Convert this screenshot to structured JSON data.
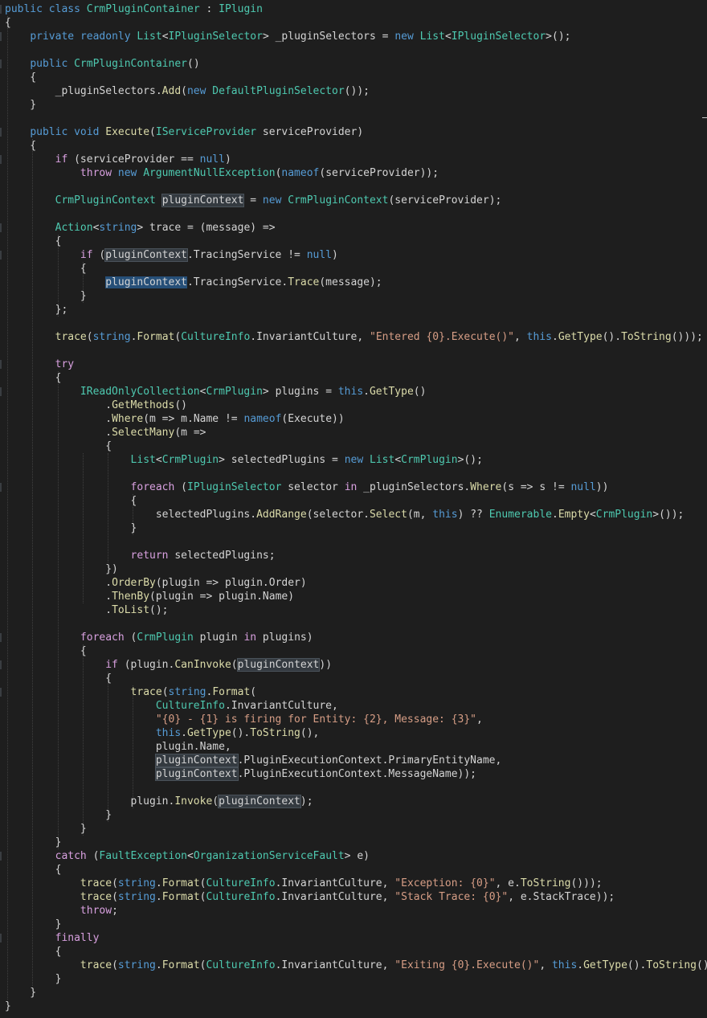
{
  "code_lines": [
    {
      "tokens": [
        {
          "t": "public",
          "c": "kw"
        },
        {
          "t": " "
        },
        {
          "t": "class",
          "c": "kw"
        },
        {
          "t": " "
        },
        {
          "t": "CrmPluginContainer",
          "c": "ty"
        },
        {
          "t": " : "
        },
        {
          "t": "IPlugin",
          "c": "ty"
        }
      ]
    },
    {
      "tokens": [
        {
          "t": "{"
        }
      ]
    },
    {
      "tokens": [
        {
          "t": "    "
        },
        {
          "t": "private",
          "c": "kw"
        },
        {
          "t": " "
        },
        {
          "t": "readonly",
          "c": "kw"
        },
        {
          "t": " "
        },
        {
          "t": "List",
          "c": "ty"
        },
        {
          "t": "<"
        },
        {
          "t": "IPluginSelector",
          "c": "ty"
        },
        {
          "t": "> _pluginSelectors = "
        },
        {
          "t": "new",
          "c": "kw"
        },
        {
          "t": " "
        },
        {
          "t": "List",
          "c": "ty"
        },
        {
          "t": "<"
        },
        {
          "t": "IPluginSelector",
          "c": "ty"
        },
        {
          "t": ">();"
        }
      ]
    },
    {
      "tokens": []
    },
    {
      "tokens": [
        {
          "t": "    "
        },
        {
          "t": "public",
          "c": "kw"
        },
        {
          "t": " "
        },
        {
          "t": "CrmPluginContainer",
          "c": "ty"
        },
        {
          "t": "()"
        }
      ]
    },
    {
      "tokens": [
        {
          "t": "    {"
        }
      ]
    },
    {
      "tokens": [
        {
          "t": "        _pluginSelectors."
        },
        {
          "t": "Add",
          "c": "fn"
        },
        {
          "t": "("
        },
        {
          "t": "new",
          "c": "kw"
        },
        {
          "t": " "
        },
        {
          "t": "DefaultPluginSelector",
          "c": "ty"
        },
        {
          "t": "());"
        }
      ]
    },
    {
      "tokens": [
        {
          "t": "    }"
        }
      ]
    },
    {
      "tokens": []
    },
    {
      "tokens": [
        {
          "t": "    "
        },
        {
          "t": "public",
          "c": "kw"
        },
        {
          "t": " "
        },
        {
          "t": "void",
          "c": "kw"
        },
        {
          "t": " "
        },
        {
          "t": "Execute",
          "c": "fn"
        },
        {
          "t": "("
        },
        {
          "t": "IServiceProvider",
          "c": "ty"
        },
        {
          "t": " serviceProvider)"
        }
      ]
    },
    {
      "tokens": [
        {
          "t": "    {"
        }
      ]
    },
    {
      "tokens": [
        {
          "t": "        "
        },
        {
          "t": "if",
          "c": "ctl"
        },
        {
          "t": " (serviceProvider == "
        },
        {
          "t": "null",
          "c": "kw"
        },
        {
          "t": ")"
        }
      ]
    },
    {
      "tokens": [
        {
          "t": "            "
        },
        {
          "t": "throw",
          "c": "ctl"
        },
        {
          "t": " "
        },
        {
          "t": "new",
          "c": "kw"
        },
        {
          "t": " "
        },
        {
          "t": "ArgumentNullException",
          "c": "ty"
        },
        {
          "t": "("
        },
        {
          "t": "nameof",
          "c": "kw"
        },
        {
          "t": "(serviceProvider));"
        }
      ]
    },
    {
      "tokens": []
    },
    {
      "tokens": [
        {
          "t": "        "
        },
        {
          "t": "CrmPluginContext",
          "c": "ty"
        },
        {
          "t": " "
        },
        {
          "t": "pluginContext",
          "c": "ref"
        },
        {
          "t": " = "
        },
        {
          "t": "new",
          "c": "kw"
        },
        {
          "t": " "
        },
        {
          "t": "CrmPluginContext",
          "c": "ty"
        },
        {
          "t": "(serviceProvider);"
        }
      ]
    },
    {
      "tokens": []
    },
    {
      "tokens": [
        {
          "t": "        "
        },
        {
          "t": "Action",
          "c": "ty"
        },
        {
          "t": "<"
        },
        {
          "t": "string",
          "c": "kw"
        },
        {
          "t": "> trace = (message) =>"
        }
      ]
    },
    {
      "tokens": [
        {
          "t": "        {"
        }
      ]
    },
    {
      "tokens": [
        {
          "t": "            "
        },
        {
          "t": "if",
          "c": "ctl"
        },
        {
          "t": " ("
        },
        {
          "t": "pluginContext",
          "c": "ref"
        },
        {
          "t": ".TracingService != "
        },
        {
          "t": "null",
          "c": "kw"
        },
        {
          "t": ")"
        }
      ]
    },
    {
      "tokens": [
        {
          "t": "            {"
        }
      ]
    },
    {
      "tokens": [
        {
          "t": "                "
        },
        {
          "t": "pluginContext",
          "c": "hl"
        },
        {
          "t": ".TracingService."
        },
        {
          "t": "Trace",
          "c": "fn"
        },
        {
          "t": "(message);"
        }
      ]
    },
    {
      "tokens": [
        {
          "t": "            }"
        }
      ]
    },
    {
      "tokens": [
        {
          "t": "        };"
        }
      ]
    },
    {
      "tokens": []
    },
    {
      "tokens": [
        {
          "t": "        "
        },
        {
          "t": "trace",
          "c": "fn"
        },
        {
          "t": "("
        },
        {
          "t": "string",
          "c": "kw"
        },
        {
          "t": "."
        },
        {
          "t": "Format",
          "c": "fn"
        },
        {
          "t": "("
        },
        {
          "t": "CultureInfo",
          "c": "ty"
        },
        {
          "t": ".InvariantCulture, "
        },
        {
          "t": "\"Entered {0}.Execute()\"",
          "c": "str"
        },
        {
          "t": ", "
        },
        {
          "t": "this",
          "c": "kw"
        },
        {
          "t": "."
        },
        {
          "t": "GetType",
          "c": "fn"
        },
        {
          "t": "()."
        },
        {
          "t": "ToString",
          "c": "fn"
        },
        {
          "t": "()));"
        }
      ]
    },
    {
      "tokens": []
    },
    {
      "tokens": [
        {
          "t": "        "
        },
        {
          "t": "try",
          "c": "ctl"
        }
      ]
    },
    {
      "tokens": [
        {
          "t": "        {"
        }
      ]
    },
    {
      "tokens": [
        {
          "t": "            "
        },
        {
          "t": "IReadOnlyCollection",
          "c": "ty"
        },
        {
          "t": "<"
        },
        {
          "t": "CrmPlugin",
          "c": "ty"
        },
        {
          "t": "> plugins = "
        },
        {
          "t": "this",
          "c": "kw"
        },
        {
          "t": "."
        },
        {
          "t": "GetType",
          "c": "fn"
        },
        {
          "t": "()"
        }
      ]
    },
    {
      "tokens": [
        {
          "t": "                ."
        },
        {
          "t": "GetMethods",
          "c": "fn"
        },
        {
          "t": "()"
        }
      ]
    },
    {
      "tokens": [
        {
          "t": "                ."
        },
        {
          "t": "Where",
          "c": "fn"
        },
        {
          "t": "(m => m.Name != "
        },
        {
          "t": "nameof",
          "c": "kw"
        },
        {
          "t": "(Execute))"
        }
      ]
    },
    {
      "tokens": [
        {
          "t": "                ."
        },
        {
          "t": "SelectMany",
          "c": "fn"
        },
        {
          "t": "(m =>"
        }
      ]
    },
    {
      "tokens": [
        {
          "t": "                {"
        }
      ]
    },
    {
      "tokens": [
        {
          "t": "                    "
        },
        {
          "t": "List",
          "c": "ty"
        },
        {
          "t": "<"
        },
        {
          "t": "CrmPlugin",
          "c": "ty"
        },
        {
          "t": "> selectedPlugins = "
        },
        {
          "t": "new",
          "c": "kw"
        },
        {
          "t": " "
        },
        {
          "t": "List",
          "c": "ty"
        },
        {
          "t": "<"
        },
        {
          "t": "CrmPlugin",
          "c": "ty"
        },
        {
          "t": ">();"
        }
      ]
    },
    {
      "tokens": []
    },
    {
      "tokens": [
        {
          "t": "                    "
        },
        {
          "t": "foreach",
          "c": "ctl"
        },
        {
          "t": " ("
        },
        {
          "t": "IPluginSelector",
          "c": "ty"
        },
        {
          "t": " selector "
        },
        {
          "t": "in",
          "c": "ctl"
        },
        {
          "t": " _pluginSelectors."
        },
        {
          "t": "Where",
          "c": "fn"
        },
        {
          "t": "(s => s != "
        },
        {
          "t": "null",
          "c": "kw"
        },
        {
          "t": "))"
        }
      ]
    },
    {
      "tokens": [
        {
          "t": "                    {"
        }
      ]
    },
    {
      "tokens": [
        {
          "t": "                        selectedPlugins."
        },
        {
          "t": "AddRange",
          "c": "fn"
        },
        {
          "t": "(selector."
        },
        {
          "t": "Select",
          "c": "fn"
        },
        {
          "t": "(m, "
        },
        {
          "t": "this",
          "c": "kw"
        },
        {
          "t": ") ?? "
        },
        {
          "t": "Enumerable",
          "c": "ty"
        },
        {
          "t": "."
        },
        {
          "t": "Empty",
          "c": "fn"
        },
        {
          "t": "<"
        },
        {
          "t": "CrmPlugin",
          "c": "ty"
        },
        {
          "t": ">());"
        }
      ]
    },
    {
      "tokens": [
        {
          "t": "                    }"
        }
      ]
    },
    {
      "tokens": []
    },
    {
      "tokens": [
        {
          "t": "                    "
        },
        {
          "t": "return",
          "c": "ctl"
        },
        {
          "t": " selectedPlugins;"
        }
      ]
    },
    {
      "tokens": [
        {
          "t": "                })"
        }
      ]
    },
    {
      "tokens": [
        {
          "t": "                ."
        },
        {
          "t": "OrderBy",
          "c": "fn"
        },
        {
          "t": "(plugin => plugin.Order)"
        }
      ]
    },
    {
      "tokens": [
        {
          "t": "                ."
        },
        {
          "t": "ThenBy",
          "c": "fn"
        },
        {
          "t": "(plugin => plugin.Name)"
        }
      ]
    },
    {
      "tokens": [
        {
          "t": "                ."
        },
        {
          "t": "ToList",
          "c": "fn"
        },
        {
          "t": "();"
        }
      ]
    },
    {
      "tokens": []
    },
    {
      "tokens": [
        {
          "t": "            "
        },
        {
          "t": "foreach",
          "c": "ctl"
        },
        {
          "t": " ("
        },
        {
          "t": "CrmPlugin",
          "c": "ty"
        },
        {
          "t": " plugin "
        },
        {
          "t": "in",
          "c": "ctl"
        },
        {
          "t": " plugins)"
        }
      ]
    },
    {
      "tokens": [
        {
          "t": "            {"
        }
      ]
    },
    {
      "tokens": [
        {
          "t": "                "
        },
        {
          "t": "if",
          "c": "ctl"
        },
        {
          "t": " (plugin."
        },
        {
          "t": "CanInvoke",
          "c": "fn"
        },
        {
          "t": "("
        },
        {
          "t": "pluginContext",
          "c": "ref"
        },
        {
          "t": "))"
        }
      ]
    },
    {
      "tokens": [
        {
          "t": "                {"
        }
      ]
    },
    {
      "tokens": [
        {
          "t": "                    "
        },
        {
          "t": "trace",
          "c": "fn"
        },
        {
          "t": "("
        },
        {
          "t": "string",
          "c": "kw"
        },
        {
          "t": "."
        },
        {
          "t": "Format",
          "c": "fn"
        },
        {
          "t": "("
        }
      ]
    },
    {
      "tokens": [
        {
          "t": "                        "
        },
        {
          "t": "CultureInfo",
          "c": "ty"
        },
        {
          "t": ".InvariantCulture,"
        }
      ]
    },
    {
      "tokens": [
        {
          "t": "                        "
        },
        {
          "t": "\"{0} - {1} is firing for Entity: {2}, Message: {3}\"",
          "c": "str"
        },
        {
          "t": ","
        }
      ]
    },
    {
      "tokens": [
        {
          "t": "                        "
        },
        {
          "t": "this",
          "c": "kw"
        },
        {
          "t": "."
        },
        {
          "t": "GetType",
          "c": "fn"
        },
        {
          "t": "()."
        },
        {
          "t": "ToString",
          "c": "fn"
        },
        {
          "t": "(),"
        }
      ]
    },
    {
      "tokens": [
        {
          "t": "                        plugin.Name,"
        }
      ]
    },
    {
      "tokens": [
        {
          "t": "                        "
        },
        {
          "t": "pluginContext",
          "c": "ref"
        },
        {
          "t": ".PluginExecutionContext.PrimaryEntityName,"
        }
      ]
    },
    {
      "tokens": [
        {
          "t": "                        "
        },
        {
          "t": "pluginContext",
          "c": "ref"
        },
        {
          "t": ".PluginExecutionContext.MessageName));"
        }
      ]
    },
    {
      "tokens": []
    },
    {
      "tokens": [
        {
          "t": "                    plugin."
        },
        {
          "t": "Invoke",
          "c": "fn"
        },
        {
          "t": "("
        },
        {
          "t": "pluginContext",
          "c": "ref"
        },
        {
          "t": ");"
        }
      ]
    },
    {
      "tokens": [
        {
          "t": "                }"
        }
      ]
    },
    {
      "tokens": [
        {
          "t": "            }"
        }
      ]
    },
    {
      "tokens": [
        {
          "t": "        }"
        }
      ]
    },
    {
      "tokens": [
        {
          "t": "        "
        },
        {
          "t": "catch",
          "c": "ctl"
        },
        {
          "t": " ("
        },
        {
          "t": "FaultException",
          "c": "ty"
        },
        {
          "t": "<"
        },
        {
          "t": "OrganizationServiceFault",
          "c": "ty"
        },
        {
          "t": "> e)"
        }
      ]
    },
    {
      "tokens": [
        {
          "t": "        {"
        }
      ]
    },
    {
      "tokens": [
        {
          "t": "            "
        },
        {
          "t": "trace",
          "c": "fn"
        },
        {
          "t": "("
        },
        {
          "t": "string",
          "c": "kw"
        },
        {
          "t": "."
        },
        {
          "t": "Format",
          "c": "fn"
        },
        {
          "t": "("
        },
        {
          "t": "CultureInfo",
          "c": "ty"
        },
        {
          "t": ".InvariantCulture, "
        },
        {
          "t": "\"Exception: {0}\"",
          "c": "str"
        },
        {
          "t": ", e."
        },
        {
          "t": "ToString",
          "c": "fn"
        },
        {
          "t": "()));"
        }
      ]
    },
    {
      "tokens": [
        {
          "t": "            "
        },
        {
          "t": "trace",
          "c": "fn"
        },
        {
          "t": "("
        },
        {
          "t": "string",
          "c": "kw"
        },
        {
          "t": "."
        },
        {
          "t": "Format",
          "c": "fn"
        },
        {
          "t": "("
        },
        {
          "t": "CultureInfo",
          "c": "ty"
        },
        {
          "t": ".InvariantCulture, "
        },
        {
          "t": "\"Stack Trace: {0}\"",
          "c": "str"
        },
        {
          "t": ", e.StackTrace));"
        }
      ]
    },
    {
      "tokens": [
        {
          "t": "            "
        },
        {
          "t": "throw",
          "c": "ctl"
        },
        {
          "t": ";"
        }
      ]
    },
    {
      "tokens": [
        {
          "t": "        }"
        }
      ]
    },
    {
      "tokens": [
        {
          "t": "        "
        },
        {
          "t": "finally",
          "c": "ctl"
        }
      ]
    },
    {
      "tokens": [
        {
          "t": "        {"
        }
      ]
    },
    {
      "tokens": [
        {
          "t": "            "
        },
        {
          "t": "trace",
          "c": "fn"
        },
        {
          "t": "("
        },
        {
          "t": "string",
          "c": "kw"
        },
        {
          "t": "."
        },
        {
          "t": "Format",
          "c": "fn"
        },
        {
          "t": "("
        },
        {
          "t": "CultureInfo",
          "c": "ty"
        },
        {
          "t": ".InvariantCulture, "
        },
        {
          "t": "\"Exiting {0}.Execute()\"",
          "c": "str"
        },
        {
          "t": ", "
        },
        {
          "t": "this",
          "c": "kw"
        },
        {
          "t": "."
        },
        {
          "t": "GetType",
          "c": "fn"
        },
        {
          "t": "()."
        },
        {
          "t": "ToString",
          "c": "fn"
        },
        {
          "t": "()));"
        }
      ]
    },
    {
      "tokens": [
        {
          "t": "        }"
        }
      ]
    },
    {
      "tokens": [
        {
          "t": "    }"
        }
      ]
    },
    {
      "tokens": [
        {
          "t": "}"
        }
      ]
    }
  ]
}
